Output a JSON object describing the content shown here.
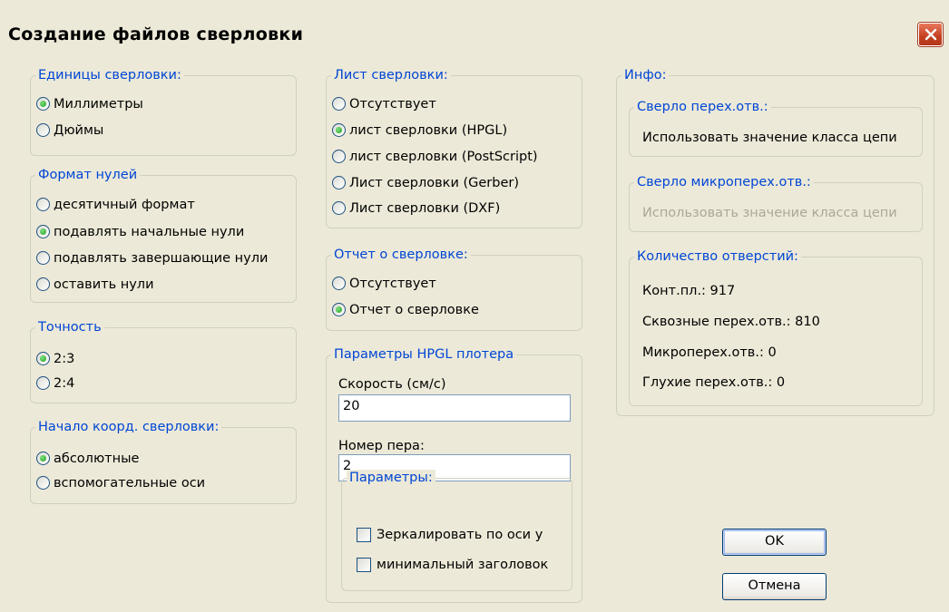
{
  "dialog": {
    "title": "Создание файлов сверловки"
  },
  "units": {
    "title": "Единицы сверловки:",
    "options": [
      {
        "label": "Миллиметры",
        "selected": true
      },
      {
        "label": "Дюймы",
        "selected": false
      }
    ]
  },
  "zeros": {
    "title": "Формат нулей",
    "options": [
      {
        "label": "десятичный формат",
        "selected": false
      },
      {
        "label": "подавлять начальные нули",
        "selected": true
      },
      {
        "label": "подавлять завершающие нули",
        "selected": false
      },
      {
        "label": "оставить нули",
        "selected": false
      }
    ]
  },
  "precision": {
    "title": "Точность",
    "options": [
      {
        "label": "2:3",
        "selected": true
      },
      {
        "label": "2:4",
        "selected": false
      }
    ]
  },
  "origin": {
    "title": "Начало коорд. сверловки:",
    "options": [
      {
        "label": "абсолютные",
        "selected": true
      },
      {
        "label": "вспомогательные оси",
        "selected": false
      }
    ]
  },
  "sheet": {
    "title": "Лист сверловки:",
    "options": [
      {
        "label": "Отсутствует",
        "selected": false
      },
      {
        "label": "лист сверловки (HPGL)",
        "selected": true
      },
      {
        "label": "лист сверловки (PostScript)",
        "selected": false
      },
      {
        "label": "Лист сверловки (Gerber)",
        "selected": false
      },
      {
        "label": "Лист сверловки (DXF)",
        "selected": false
      }
    ]
  },
  "report": {
    "title": "Отчет о сверловке:",
    "options": [
      {
        "label": "Отсутствует",
        "selected": false
      },
      {
        "label": "Отчет о сверловке",
        "selected": true
      }
    ]
  },
  "hpgl": {
    "title": "Параметры HPGL плотера",
    "speed_label": "Скорость (см/с)",
    "speed_value": "20",
    "pen_label": "Номер пера:",
    "pen_value": "2",
    "params": {
      "title": "Параметры:",
      "mirror_label": "Зеркалировать по оси y",
      "mirror_checked": false,
      "minheader_label": "минимальный заголовок",
      "minheader_checked": false
    }
  },
  "info": {
    "title": "Инфо:",
    "via_drill": {
      "title": "Сверло перех.отв.:",
      "value": "Использовать значение класса цепи"
    },
    "microvia_drill": {
      "title": "Сверло микроперех.отв.:",
      "value": "Использовать значение класса цепи"
    },
    "holes": {
      "title": "Количество отверстий:",
      "lines": [
        "Конт.пл.: 917",
        "Сквозные перех.отв.: 810",
        "Микроперех.отв.: 0",
        "Глухие перех.отв.: 0"
      ]
    }
  },
  "buttons": {
    "ok": "OK",
    "cancel": "Отмена"
  },
  "colors": {
    "group_title": "#0046d5",
    "dialog_bg": "#ece9d8",
    "disabled_text": "#aca899"
  }
}
